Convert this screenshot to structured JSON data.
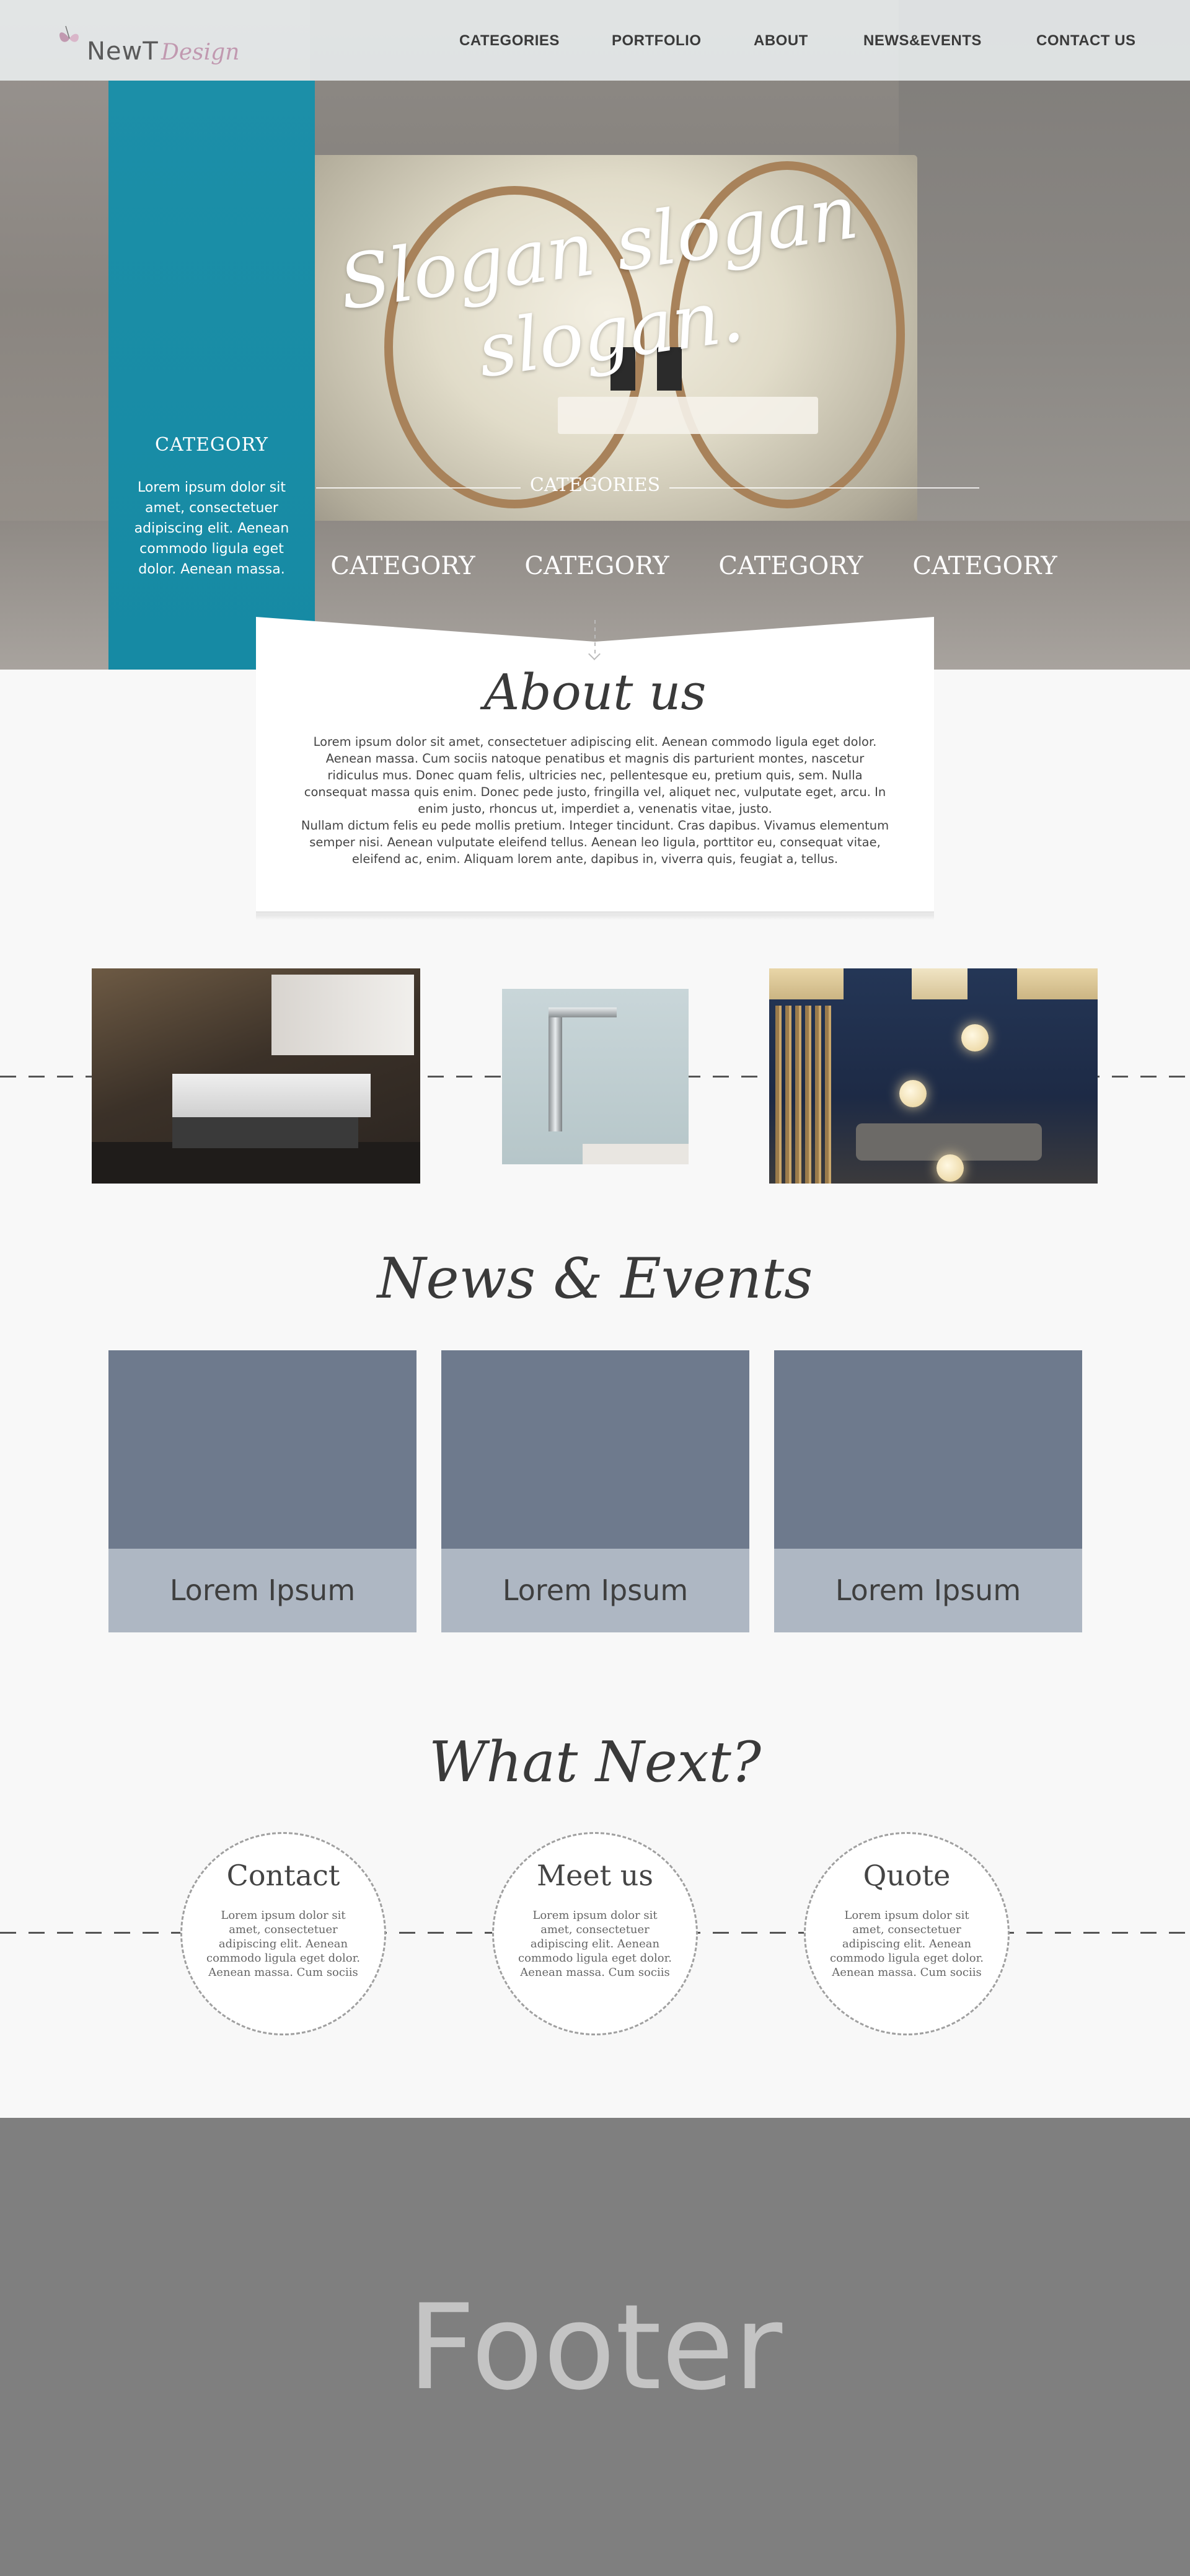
{
  "brand": {
    "name_part1": "NewT",
    "name_part2": "Design",
    "accent_color": "#c199b0"
  },
  "nav": {
    "items": [
      {
        "label": "CATEGORIES"
      },
      {
        "label": "PORTFOLIO"
      },
      {
        "label": "ABOUT"
      },
      {
        "label": "NEWS&EVENTS"
      },
      {
        "label": "CONTACT US"
      }
    ]
  },
  "hero": {
    "slogan": "Slogan slogan slogan.",
    "categories_heading": "CATEGORIES",
    "categories": [
      "CATEGORY",
      "CATEGORY",
      "CATEGORY",
      "CATEGORY"
    ],
    "panel": {
      "title": "CATEGORY",
      "text": "Lorem ipsum dolor sit amet, consectetuer adipiscing elit. Aenean commodo ligula eget dolor. Aenean massa.",
      "color": "#168aa4"
    }
  },
  "about": {
    "title": "About us",
    "paragraph1": "Lorem ipsum dolor sit amet, consectetuer adipiscing elit. Aenean commodo ligula eget dolor. Aenean massa. Cum sociis natoque penatibus et magnis dis parturient montes, nascetur ridiculus mus. Donec quam felis, ultricies nec, pellentesque eu, pretium quis, sem. Nulla consequat massa quis enim. Donec pede justo, fringilla vel, aliquet nec, vulputate eget, arcu. In enim justo, rhoncus ut, imperdiet a, venenatis vitae, justo.",
    "paragraph2": "Nullam dictum felis eu pede mollis pretium. Integer tincidunt. Cras dapibus. Vivamus elementum semper nisi. Aenean vulputate eleifend tellus. Aenean leo ligula, porttitor eu, consequat vitae, eleifend ac, enim. Aliquam lorem ante, dapibus in, viverra quis, feugiat a, tellus."
  },
  "news": {
    "title": "News & Events",
    "cards": [
      {
        "caption": "Lorem Ipsum"
      },
      {
        "caption": "Lorem Ipsum"
      },
      {
        "caption": "Lorem Ipsum"
      }
    ],
    "image_color": "#6e7a8d",
    "caption_color": "#aeb7c3"
  },
  "next": {
    "title": "What Next?",
    "items": [
      {
        "title": "Contact",
        "text": "Lorem ipsum dolor sit amet, consectetuer adipiscing elit. Aenean commodo ligula eget dolor. Aenean massa. Cum sociis natoque penatibus et magnis dis parturient montes, nascetur"
      },
      {
        "title": "Meet us",
        "text": "Lorem ipsum dolor sit amet, consectetuer adipiscing elit. Aenean commodo ligula eget dolor. Aenean massa. Cum sociis natoque penatibus et magnis dis parturient montes, nascetur"
      },
      {
        "title": "Quote",
        "text": "Lorem ipsum dolor sit amet, consectetuer adipiscing elit. Aenean commodo ligula eget dolor. Aenean massa. Cum sociis natoque penatibus et magnis dis parturient montes, nascetur"
      }
    ]
  },
  "footer": {
    "text": "Footer",
    "color": "#7f7f7f"
  }
}
